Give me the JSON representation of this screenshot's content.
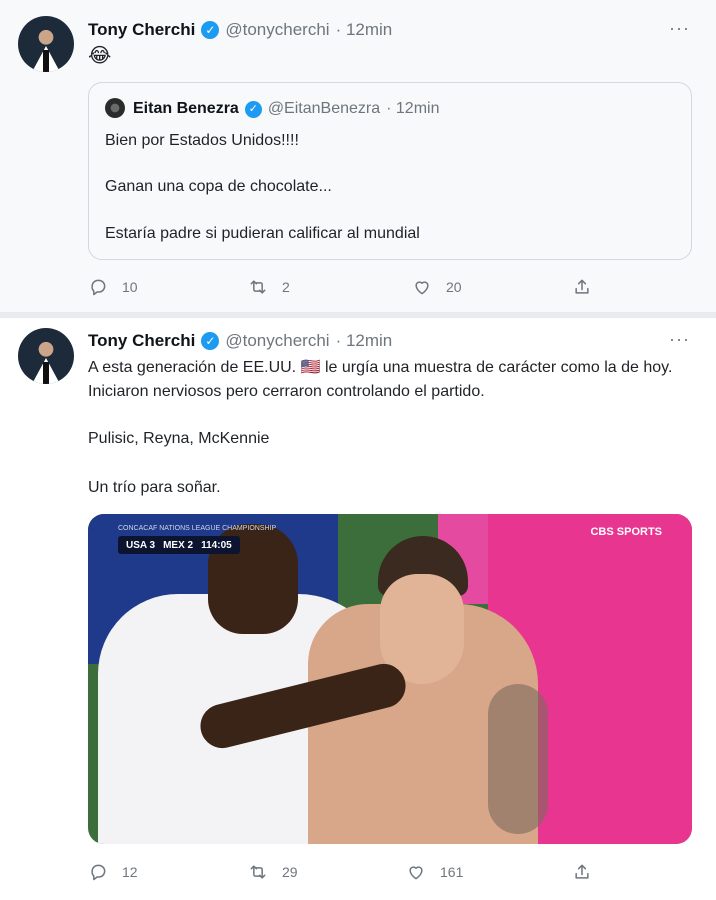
{
  "tweets": [
    {
      "author": {
        "name": "Tony Cherchi",
        "handle": "@tonycherchi",
        "time": "· 12min"
      },
      "text": "😂",
      "quote": {
        "author": {
          "name": "Eitan Benezra",
          "handle": "@EitanBenezra",
          "time": "· 12min"
        },
        "lines": [
          "Bien por Estados Unidos!!!!",
          "Ganan una copa de chocolate...",
          "Estaría padre si pudieran calificar al mundial"
        ]
      },
      "stats": {
        "replies": "10",
        "retweets": "2",
        "likes": "20"
      }
    },
    {
      "author": {
        "name": "Tony Cherchi",
        "handle": "@tonycherchi",
        "time": "· 12min"
      },
      "lines": [
        "A esta generación de EE.UU. 🇺🇸 le urgía una muestra de carácter como la de hoy. Iniciaron nerviosos pero cerraron controlando el partido.",
        "Pulisic, Reyna, McKennie",
        "Un trío para soñar."
      ],
      "media": {
        "scoreboard_title": "CONCACAF NATIONS LEAGUE CHAMPIONSHIP",
        "score_left": "USA 3",
        "score_right": "MEX 2",
        "clock": "114:05",
        "broadcaster": "CBS SPORTS"
      },
      "stats": {
        "replies": "12",
        "retweets": "29",
        "likes": "161"
      }
    }
  ],
  "icons": {
    "verified": "verified-badge-icon",
    "more": "more-icon",
    "reply": "reply-icon",
    "retweet": "retweet-icon",
    "like": "heart-icon",
    "share": "share-icon"
  },
  "glyphs": {
    "check": "✓",
    "more": "···"
  },
  "colors": {
    "verified": "#1d9bf0",
    "muted": "#6e767d",
    "border": "#cfd9de"
  }
}
